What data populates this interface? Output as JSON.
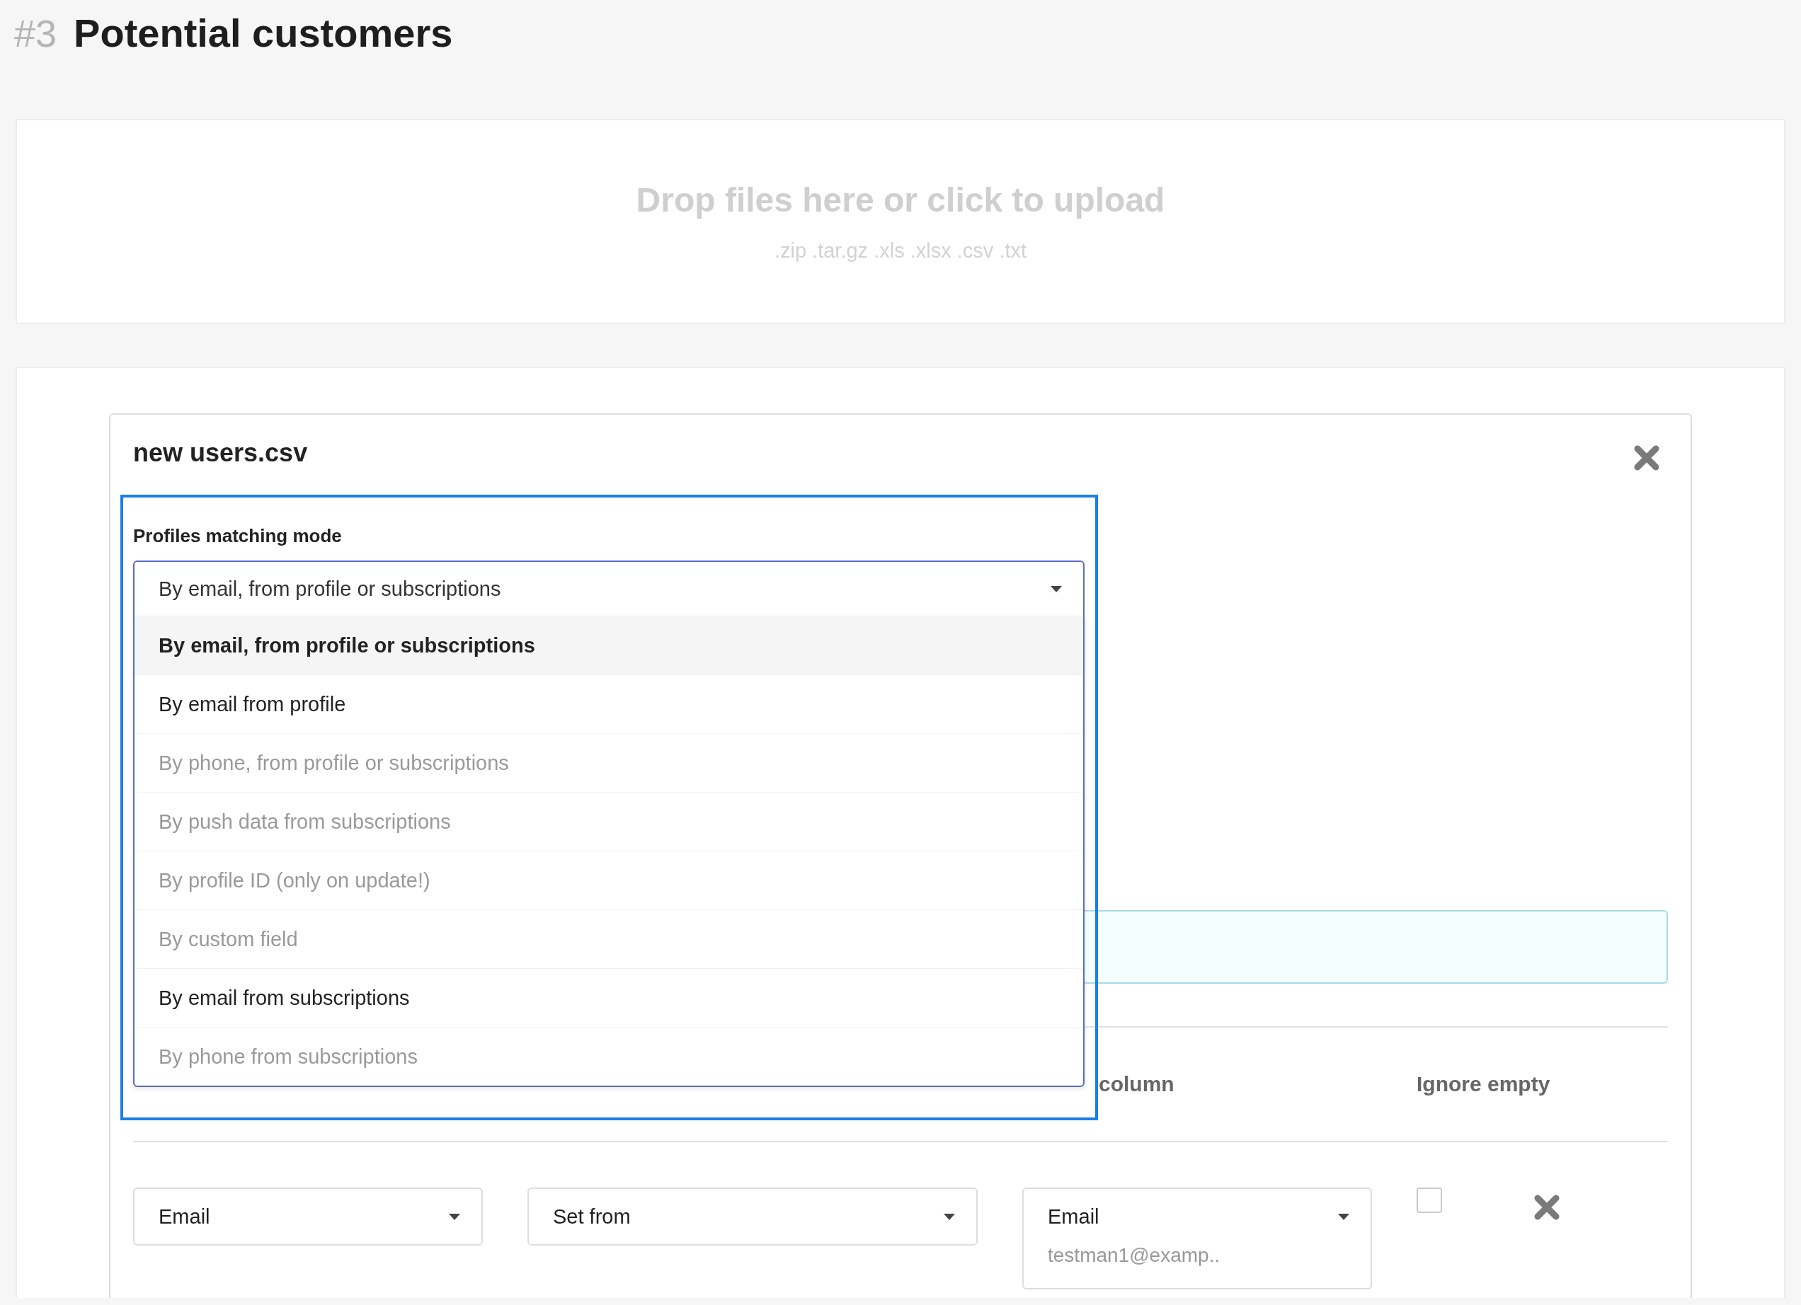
{
  "page": {
    "number": "#3",
    "title": "Potential customers"
  },
  "upload": {
    "title": "Drop files here or click to upload",
    "extensions": ".zip .tar.gz .xls .xlsx .csv .txt"
  },
  "file": {
    "name": "new users.csv",
    "matching": {
      "label": "Profiles matching mode",
      "value": "By email, from profile or subscriptions",
      "expanded": true,
      "options": [
        {
          "label": "By email, from profile or subscriptions",
          "selected": true,
          "disabled": false
        },
        {
          "label": "By email from profile",
          "selected": false,
          "disabled": false
        },
        {
          "label": "By phone, from profile or subscriptions",
          "selected": false,
          "disabled": true
        },
        {
          "label": "By push data from subscriptions",
          "selected": false,
          "disabled": true
        },
        {
          "label": "By profile ID (only on update!)",
          "selected": false,
          "disabled": true
        },
        {
          "label": "By custom field",
          "selected": false,
          "disabled": true
        },
        {
          "label": "By email from subscriptions",
          "selected": false,
          "disabled": false
        },
        {
          "label": "By phone from subscriptions",
          "selected": false,
          "disabled": true
        }
      ]
    },
    "columns": [
      {
        "kind": "source",
        "label": "column"
      },
      {
        "kind": "ignore",
        "label": "Ignore empty"
      }
    ],
    "rows": [
      {
        "database_column": "Email",
        "action": "Set from",
        "source_column": "Email",
        "sample": "testman1@examp..",
        "ignore_empty": false
      }
    ]
  }
}
